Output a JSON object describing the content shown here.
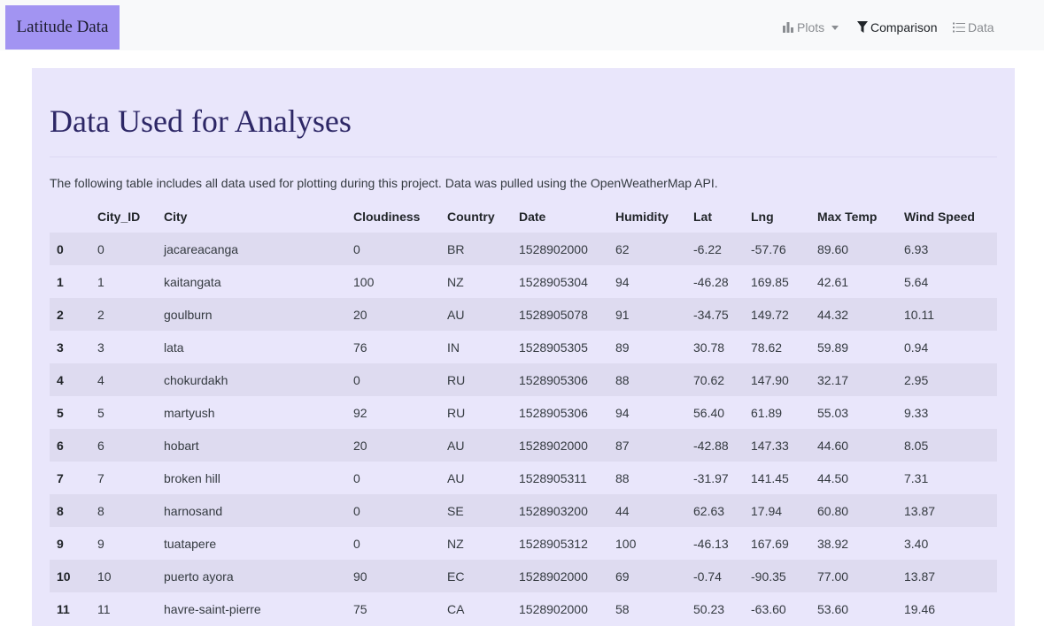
{
  "navbar": {
    "brand": "Latitude Data",
    "plots_label": "Plots",
    "comparison_label": "Comparison",
    "data_label": "Data"
  },
  "page": {
    "title": "Data Used for Analyses",
    "intro": "The following table includes all data used for plotting during this project. Data was pulled using the OpenWeatherMap API."
  },
  "table": {
    "columns": [
      "",
      "City_ID",
      "City",
      "Cloudiness",
      "Country",
      "Date",
      "Humidity",
      "Lat",
      "Lng",
      "Max Temp",
      "Wind Speed"
    ],
    "rows": [
      [
        "0",
        "0",
        "jacareacanga",
        "0",
        "BR",
        "1528902000",
        "62",
        "-6.22",
        "-57.76",
        "89.60",
        "6.93"
      ],
      [
        "1",
        "1",
        "kaitangata",
        "100",
        "NZ",
        "1528905304",
        "94",
        "-46.28",
        "169.85",
        "42.61",
        "5.64"
      ],
      [
        "2",
        "2",
        "goulburn",
        "20",
        "AU",
        "1528905078",
        "91",
        "-34.75",
        "149.72",
        "44.32",
        "10.11"
      ],
      [
        "3",
        "3",
        "lata",
        "76",
        "IN",
        "1528905305",
        "89",
        "30.78",
        "78.62",
        "59.89",
        "0.94"
      ],
      [
        "4",
        "4",
        "chokurdakh",
        "0",
        "RU",
        "1528905306",
        "88",
        "70.62",
        "147.90",
        "32.17",
        "2.95"
      ],
      [
        "5",
        "5",
        "martyush",
        "92",
        "RU",
        "1528905306",
        "94",
        "56.40",
        "61.89",
        "55.03",
        "9.33"
      ],
      [
        "6",
        "6",
        "hobart",
        "20",
        "AU",
        "1528902000",
        "87",
        "-42.88",
        "147.33",
        "44.60",
        "8.05"
      ],
      [
        "7",
        "7",
        "broken hill",
        "0",
        "AU",
        "1528905311",
        "88",
        "-31.97",
        "141.45",
        "44.50",
        "7.31"
      ],
      [
        "8",
        "8",
        "harnosand",
        "0",
        "SE",
        "1528903200",
        "44",
        "62.63",
        "17.94",
        "60.80",
        "13.87"
      ],
      [
        "9",
        "9",
        "tuatapere",
        "0",
        "NZ",
        "1528905312",
        "100",
        "-46.13",
        "167.69",
        "38.92",
        "3.40"
      ],
      [
        "10",
        "10",
        "puerto ayora",
        "90",
        "EC",
        "1528902000",
        "69",
        "-0.74",
        "-90.35",
        "77.00",
        "13.87"
      ],
      [
        "11",
        "11",
        "havre-saint-pierre",
        "75",
        "CA",
        "1528902000",
        "58",
        "50.23",
        "-63.60",
        "53.60",
        "19.46"
      ]
    ]
  }
}
